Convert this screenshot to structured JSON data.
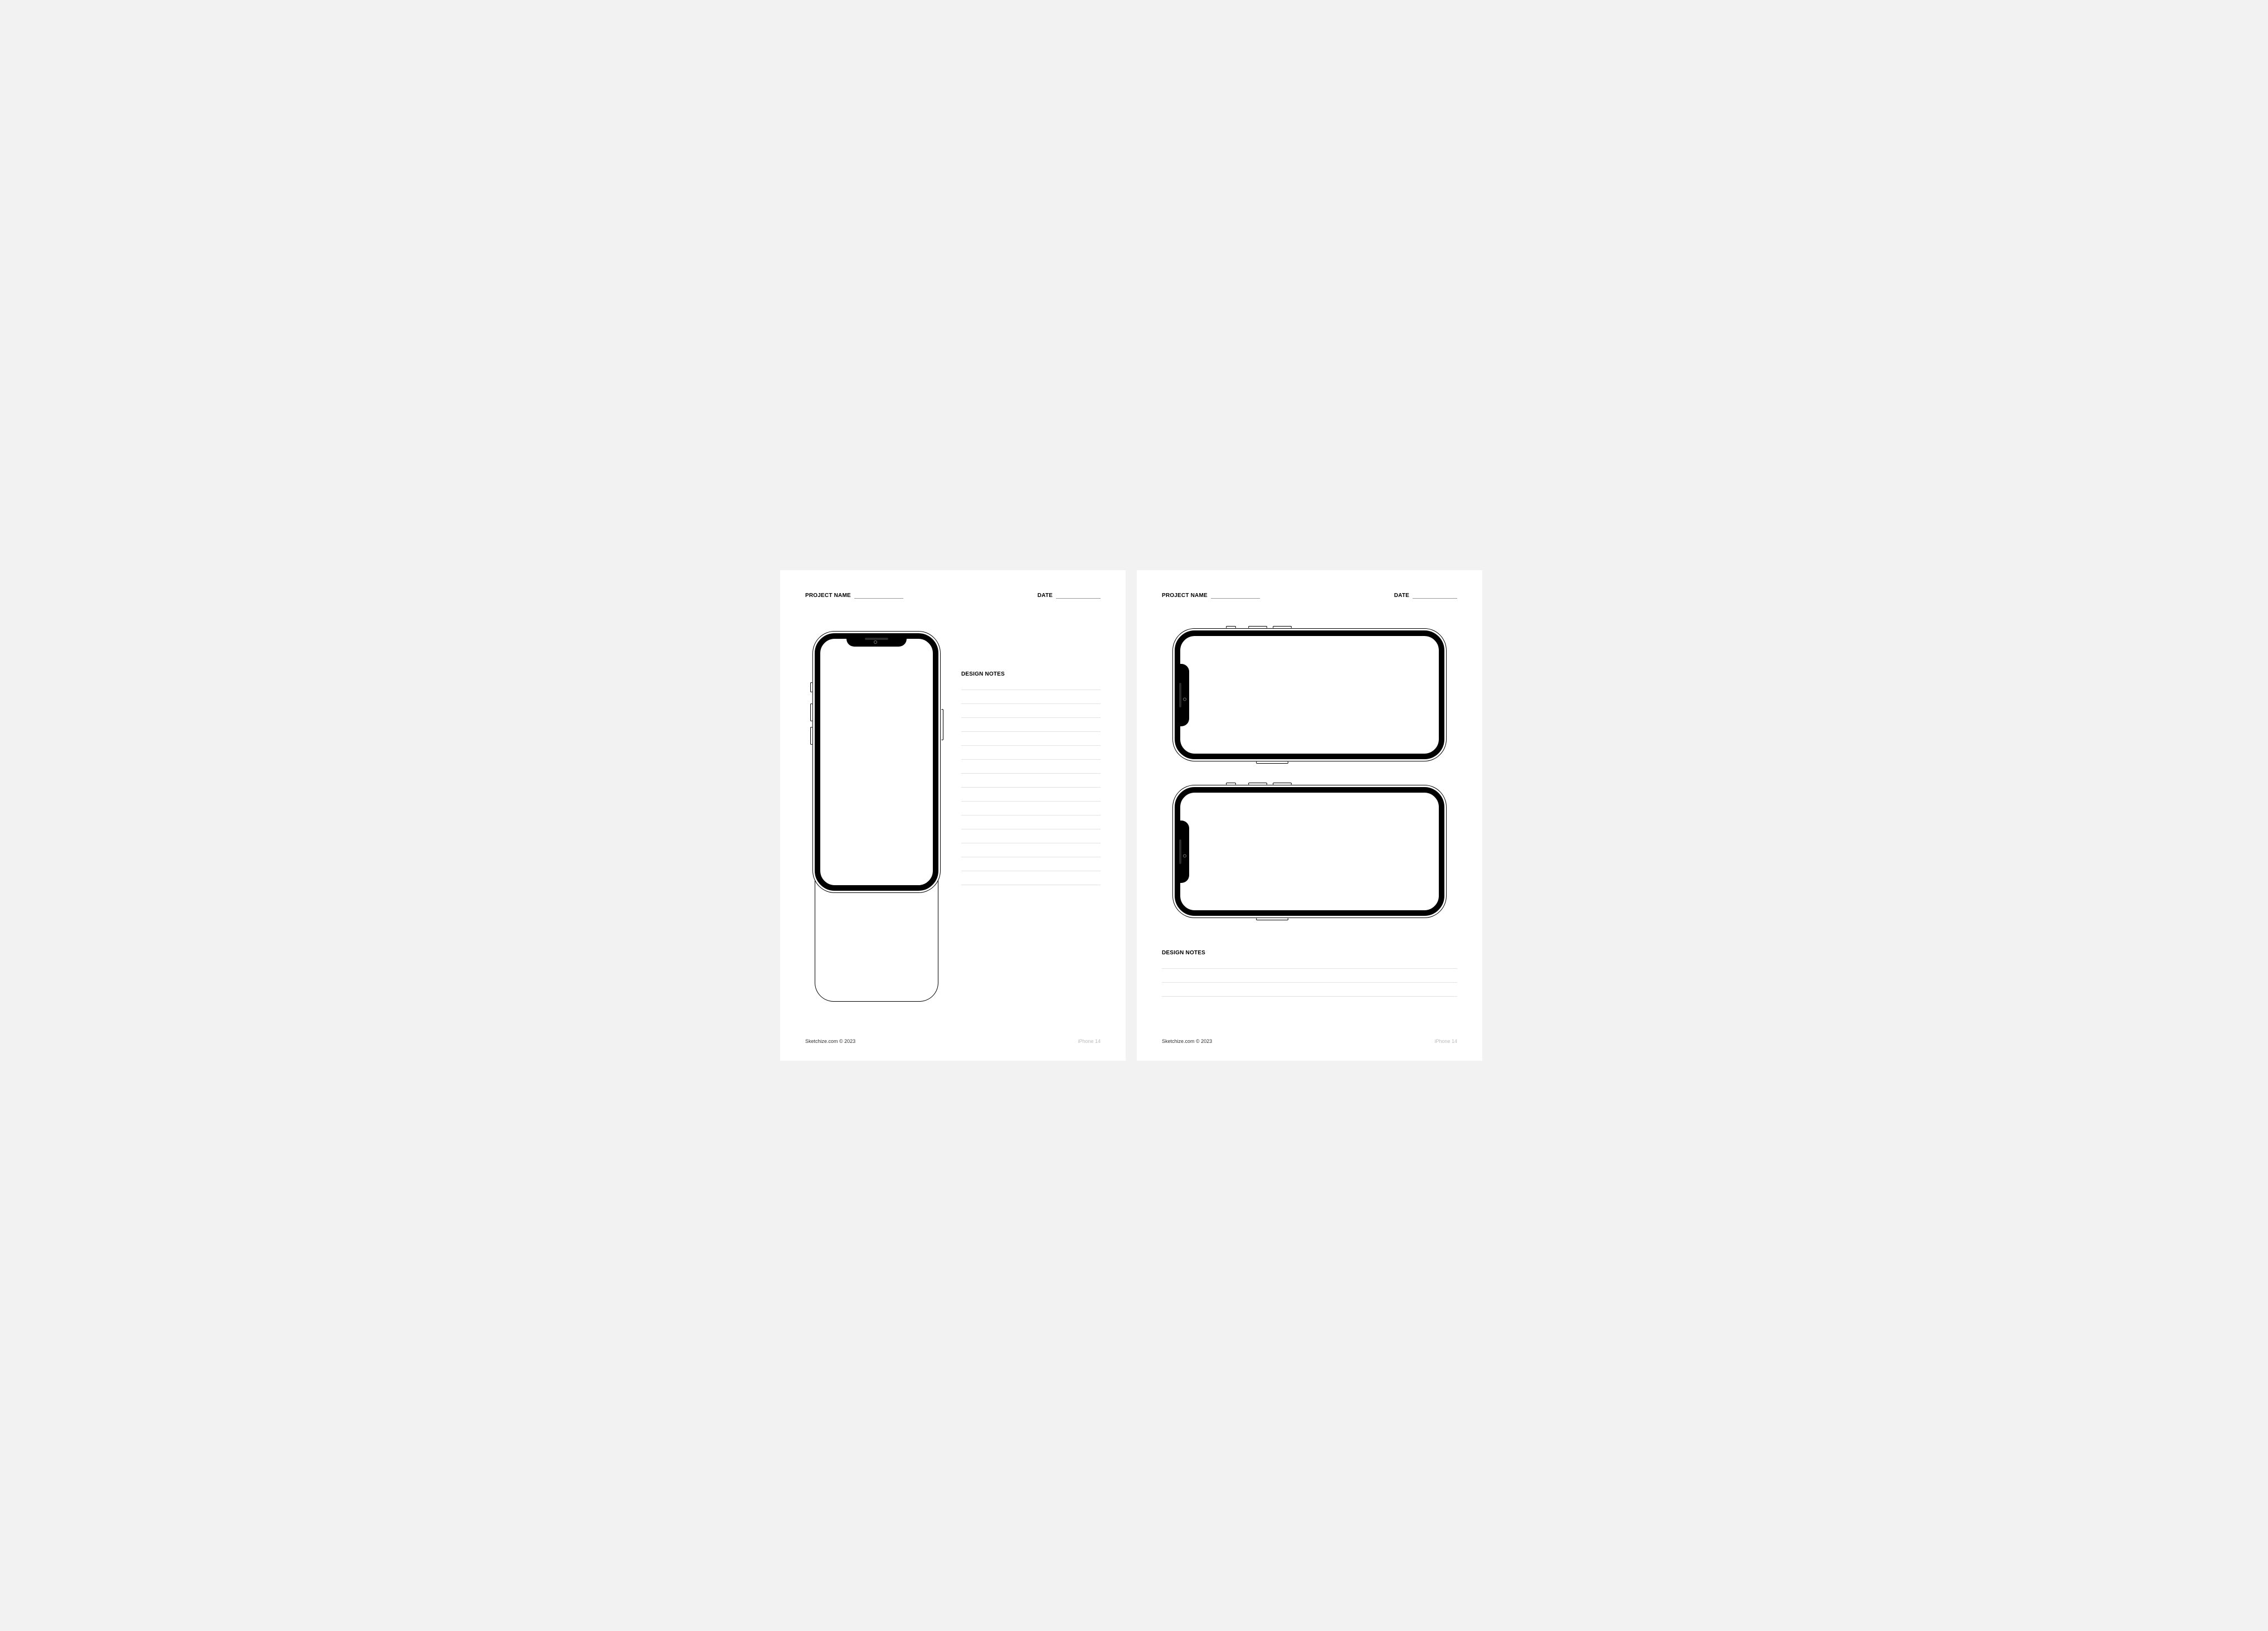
{
  "labels": {
    "project_name": "PROJECT NAME",
    "date": "DATE",
    "design_notes": "DESIGN NOTES"
  },
  "footer": {
    "credit": "Sketchize.com © 2023",
    "model": "iPhone 14"
  },
  "pages": {
    "left": {
      "orientation": "portrait",
      "note_lines": 15
    },
    "right": {
      "orientation": "landscape",
      "phone_count": 2,
      "note_lines": 3
    }
  }
}
